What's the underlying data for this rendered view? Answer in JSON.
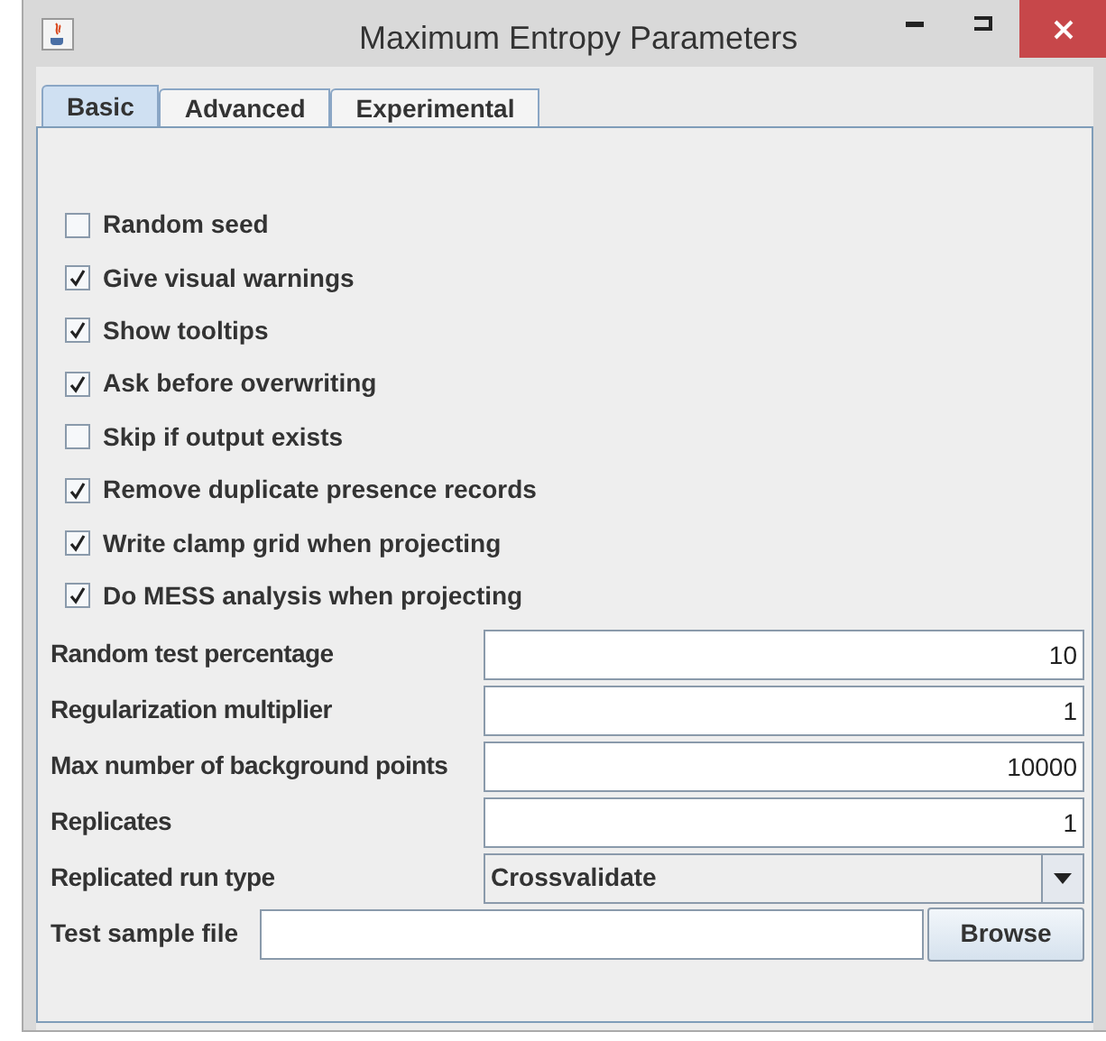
{
  "window": {
    "title": "Maximum Entropy Parameters"
  },
  "tabs": [
    {
      "label": "Basic",
      "selected": true
    },
    {
      "label": "Advanced",
      "selected": false
    },
    {
      "label": "Experimental",
      "selected": false
    }
  ],
  "checkboxes": [
    {
      "label": "Random seed",
      "checked": false
    },
    {
      "label": "Give visual warnings",
      "checked": true
    },
    {
      "label": "Show tooltips",
      "checked": true
    },
    {
      "label": "Ask before overwriting",
      "checked": true
    },
    {
      "label": "Skip if output exists",
      "checked": false
    },
    {
      "label": "Remove duplicate presence records",
      "checked": true
    },
    {
      "label": "Write clamp grid when projecting",
      "checked": true
    },
    {
      "label": "Do MESS analysis when projecting",
      "checked": true
    }
  ],
  "fields": [
    {
      "kind": "text",
      "label": "Random test percentage",
      "value": "10"
    },
    {
      "kind": "text",
      "label": "Regularization multiplier",
      "value": "1"
    },
    {
      "kind": "text",
      "label": "Max number of background points",
      "value": "10000"
    },
    {
      "kind": "text",
      "label": "Replicates",
      "value": "1"
    },
    {
      "kind": "dropdown",
      "label": "Replicated run type",
      "value": "Crossvalidate"
    },
    {
      "kind": "file",
      "label": "Test sample file",
      "button": "Browse"
    }
  ]
}
